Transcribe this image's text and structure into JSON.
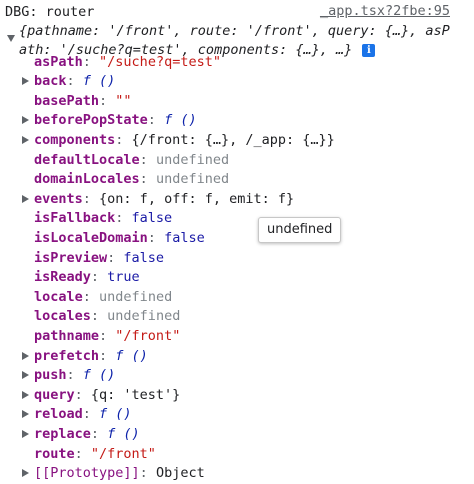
{
  "header": {
    "label": "DBG: router",
    "source_link": "_app.tsx?2fbe:95"
  },
  "summary": {
    "line1": "{pathname: '/front', route: '/front', query: {…}, asP",
    "line2": "ath: '/suche?q=test', components: {…}, …}",
    "info_glyph": "i"
  },
  "props": [
    {
      "key": "asPath",
      "value": "\"/suche?q=test\"",
      "type": "string",
      "expandable": false
    },
    {
      "key": "back",
      "value": "f ()",
      "type": "function",
      "expandable": true
    },
    {
      "key": "basePath",
      "value": "\"\"",
      "type": "string",
      "expandable": false
    },
    {
      "key": "beforePopState",
      "value": "f ()",
      "type": "function",
      "expandable": true
    },
    {
      "key": "components",
      "value": "{/front: {…}, /_app: {…}}",
      "type": "object",
      "expandable": true
    },
    {
      "key": "defaultLocale",
      "value": "undefined",
      "type": "undefined",
      "expandable": false
    },
    {
      "key": "domainLocales",
      "value": "undefined",
      "type": "undefined",
      "expandable": false
    },
    {
      "key": "events",
      "value": "{on: f, off: f, emit: f}",
      "type": "object",
      "expandable": true
    },
    {
      "key": "isFallback",
      "value": "false",
      "type": "keyword",
      "expandable": false
    },
    {
      "key": "isLocaleDomain",
      "value": "false",
      "type": "keyword",
      "expandable": false
    },
    {
      "key": "isPreview",
      "value": "false",
      "type": "keyword",
      "expandable": false
    },
    {
      "key": "isReady",
      "value": "true",
      "type": "keyword",
      "expandable": false
    },
    {
      "key": "locale",
      "value": "undefined",
      "type": "undefined",
      "expandable": false
    },
    {
      "key": "locales",
      "value": "undefined",
      "type": "undefined",
      "expandable": false
    },
    {
      "key": "pathname",
      "value": "\"/front\"",
      "type": "string",
      "expandable": false
    },
    {
      "key": "prefetch",
      "value": "f ()",
      "type": "function",
      "expandable": true
    },
    {
      "key": "push",
      "value": "f ()",
      "type": "function",
      "expandable": true
    },
    {
      "key": "query",
      "value": "{q: 'test'}",
      "type": "object",
      "expandable": true
    },
    {
      "key": "reload",
      "value": "f ()",
      "type": "function",
      "expandable": true
    },
    {
      "key": "replace",
      "value": "f ()",
      "type": "function",
      "expandable": true
    },
    {
      "key": "route",
      "value": "\"/front\"",
      "type": "string",
      "expandable": false
    },
    {
      "key": "[[Prototype]]",
      "value": "Object",
      "type": "internal",
      "expandable": true
    }
  ],
  "tooltip": "undefined"
}
